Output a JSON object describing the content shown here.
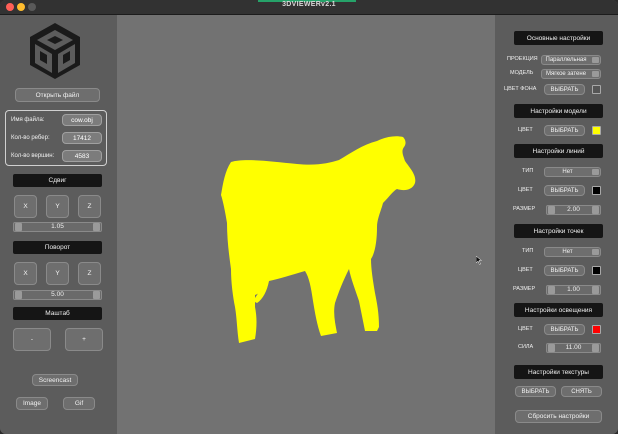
{
  "window": {
    "title": "3DVIEWERv2.1"
  },
  "left": {
    "open_file": "Открыть файл",
    "info": {
      "filename_label": "Имя файла:",
      "filename": "cow.obj",
      "edges_label": "Кол-во ребер:",
      "edges": "17412",
      "vertices_label": "Кол-во вершин:",
      "vertices": "4583"
    },
    "move": {
      "header": "Сдвиг",
      "x": "X",
      "y": "Y",
      "z": "Z",
      "value": "1.05"
    },
    "rotate": {
      "header": "Поворот",
      "x": "X",
      "y": "Y",
      "z": "Z",
      "value": "5.00"
    },
    "scale": {
      "header": "Маштаб",
      "minus": "-",
      "plus": "+"
    },
    "screencast": "Screencast",
    "image": "Image",
    "gif": "Gif"
  },
  "viewport": {
    "model_color": "#ffff00",
    "background": "#727272"
  },
  "right": {
    "basic": {
      "header": "Основные настройки",
      "projection_label": "ПРОЕКЦИЯ",
      "projection": "Параллельная",
      "model_label": "МОДЕЛЬ",
      "model": "Мягкое затене",
      "bg_label": "ЦВЕТ ФОНА",
      "bg_button": "ВЫБРАТЬ",
      "bg_color": "#555555"
    },
    "model": {
      "header": "Настройки модели",
      "color_label": "ЦВЕТ",
      "button": "ВЫБРАТЬ",
      "color": "#ffff00"
    },
    "lines": {
      "header": "Настройки линий",
      "type_label": "ТИП",
      "type": "Нет",
      "color_label": "ЦВЕТ",
      "button": "ВЫБРАТЬ",
      "color": "#000000",
      "size_label": "РАЗМЕР",
      "size": "2.00"
    },
    "points": {
      "header": "Настройки точек",
      "type_label": "ТИП",
      "type": "Нет",
      "color_label": "ЦВЕТ",
      "button": "ВЫБРАТЬ",
      "color": "#000000",
      "size_label": "РАЗМЕР",
      "size": "1.00"
    },
    "lighting": {
      "header": "Настройки освещения",
      "color_label": "ЦВЕТ",
      "button": "ВЫБРАТЬ",
      "color": "#ff0000",
      "strength_label": "СИЛА",
      "strength": "11.00"
    },
    "texture": {
      "header": "Настройки текстуры",
      "choose": "ВЫБРАТЬ",
      "remove": "СНЯТЬ"
    },
    "reset": "Сбросить настройки"
  }
}
